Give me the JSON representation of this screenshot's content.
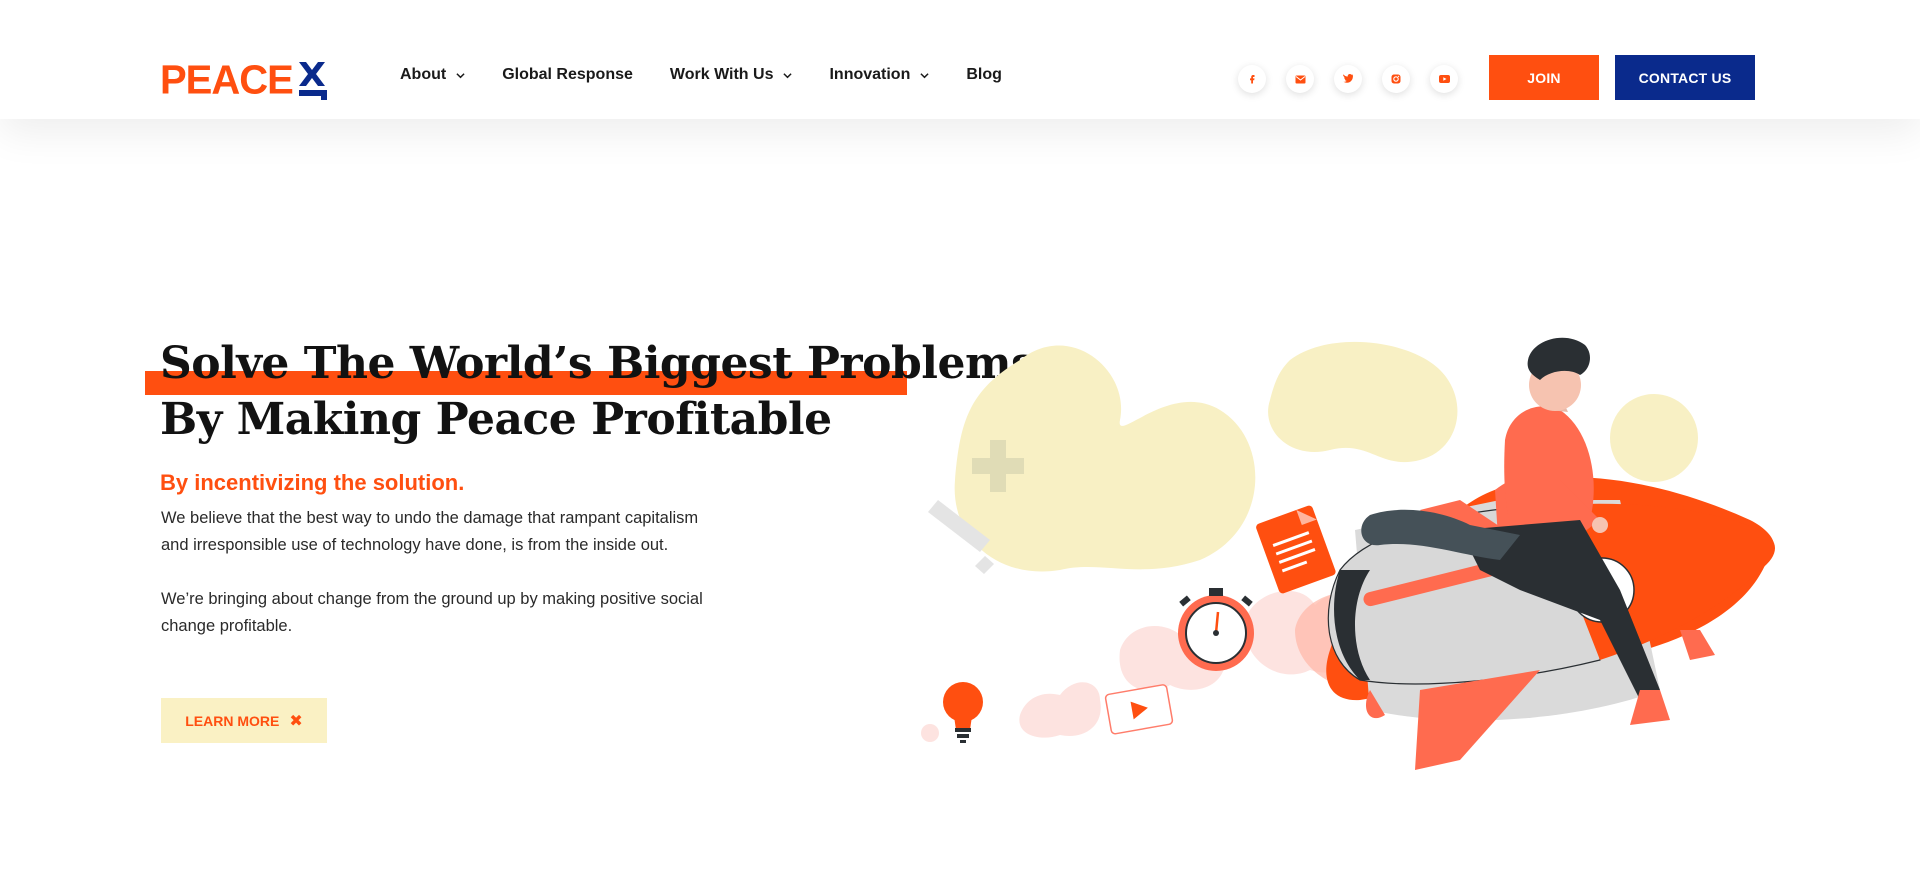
{
  "header": {
    "logo_text": "PEACE",
    "nav": [
      {
        "label": "About",
        "has_dropdown": true
      },
      {
        "label": "Global Response",
        "has_dropdown": false
      },
      {
        "label": "Work With Us",
        "has_dropdown": true
      },
      {
        "label": "Innovation",
        "has_dropdown": true
      },
      {
        "label": "Blog",
        "has_dropdown": false
      }
    ],
    "socials": [
      "facebook-icon",
      "email-icon",
      "twitter-icon",
      "instagram-icon",
      "youtube-icon"
    ],
    "join_label": "JOIN",
    "contact_label": "CONTACT US"
  },
  "hero": {
    "title_line1": "Solve The World’s Biggest Problems",
    "title_line2": "By Making Peace Profitable",
    "subtitle": "By incentivizing the solution.",
    "paragraph1": "We believe that the best way to undo the damage that rampant capitalism and irresponsible use of technology have done, is from the inside out.",
    "paragraph2": "We’re bringing about change from the ground up by making positive social change profitable.",
    "cta_label": "LEARN MORE",
    "cta_icon": "x-icon"
  },
  "colors": {
    "brand_orange": "#ff4f10",
    "brand_navy": "#0a2a8c",
    "cta_bg": "#faf1c4",
    "blob_yellow": "#f8f0c4"
  }
}
